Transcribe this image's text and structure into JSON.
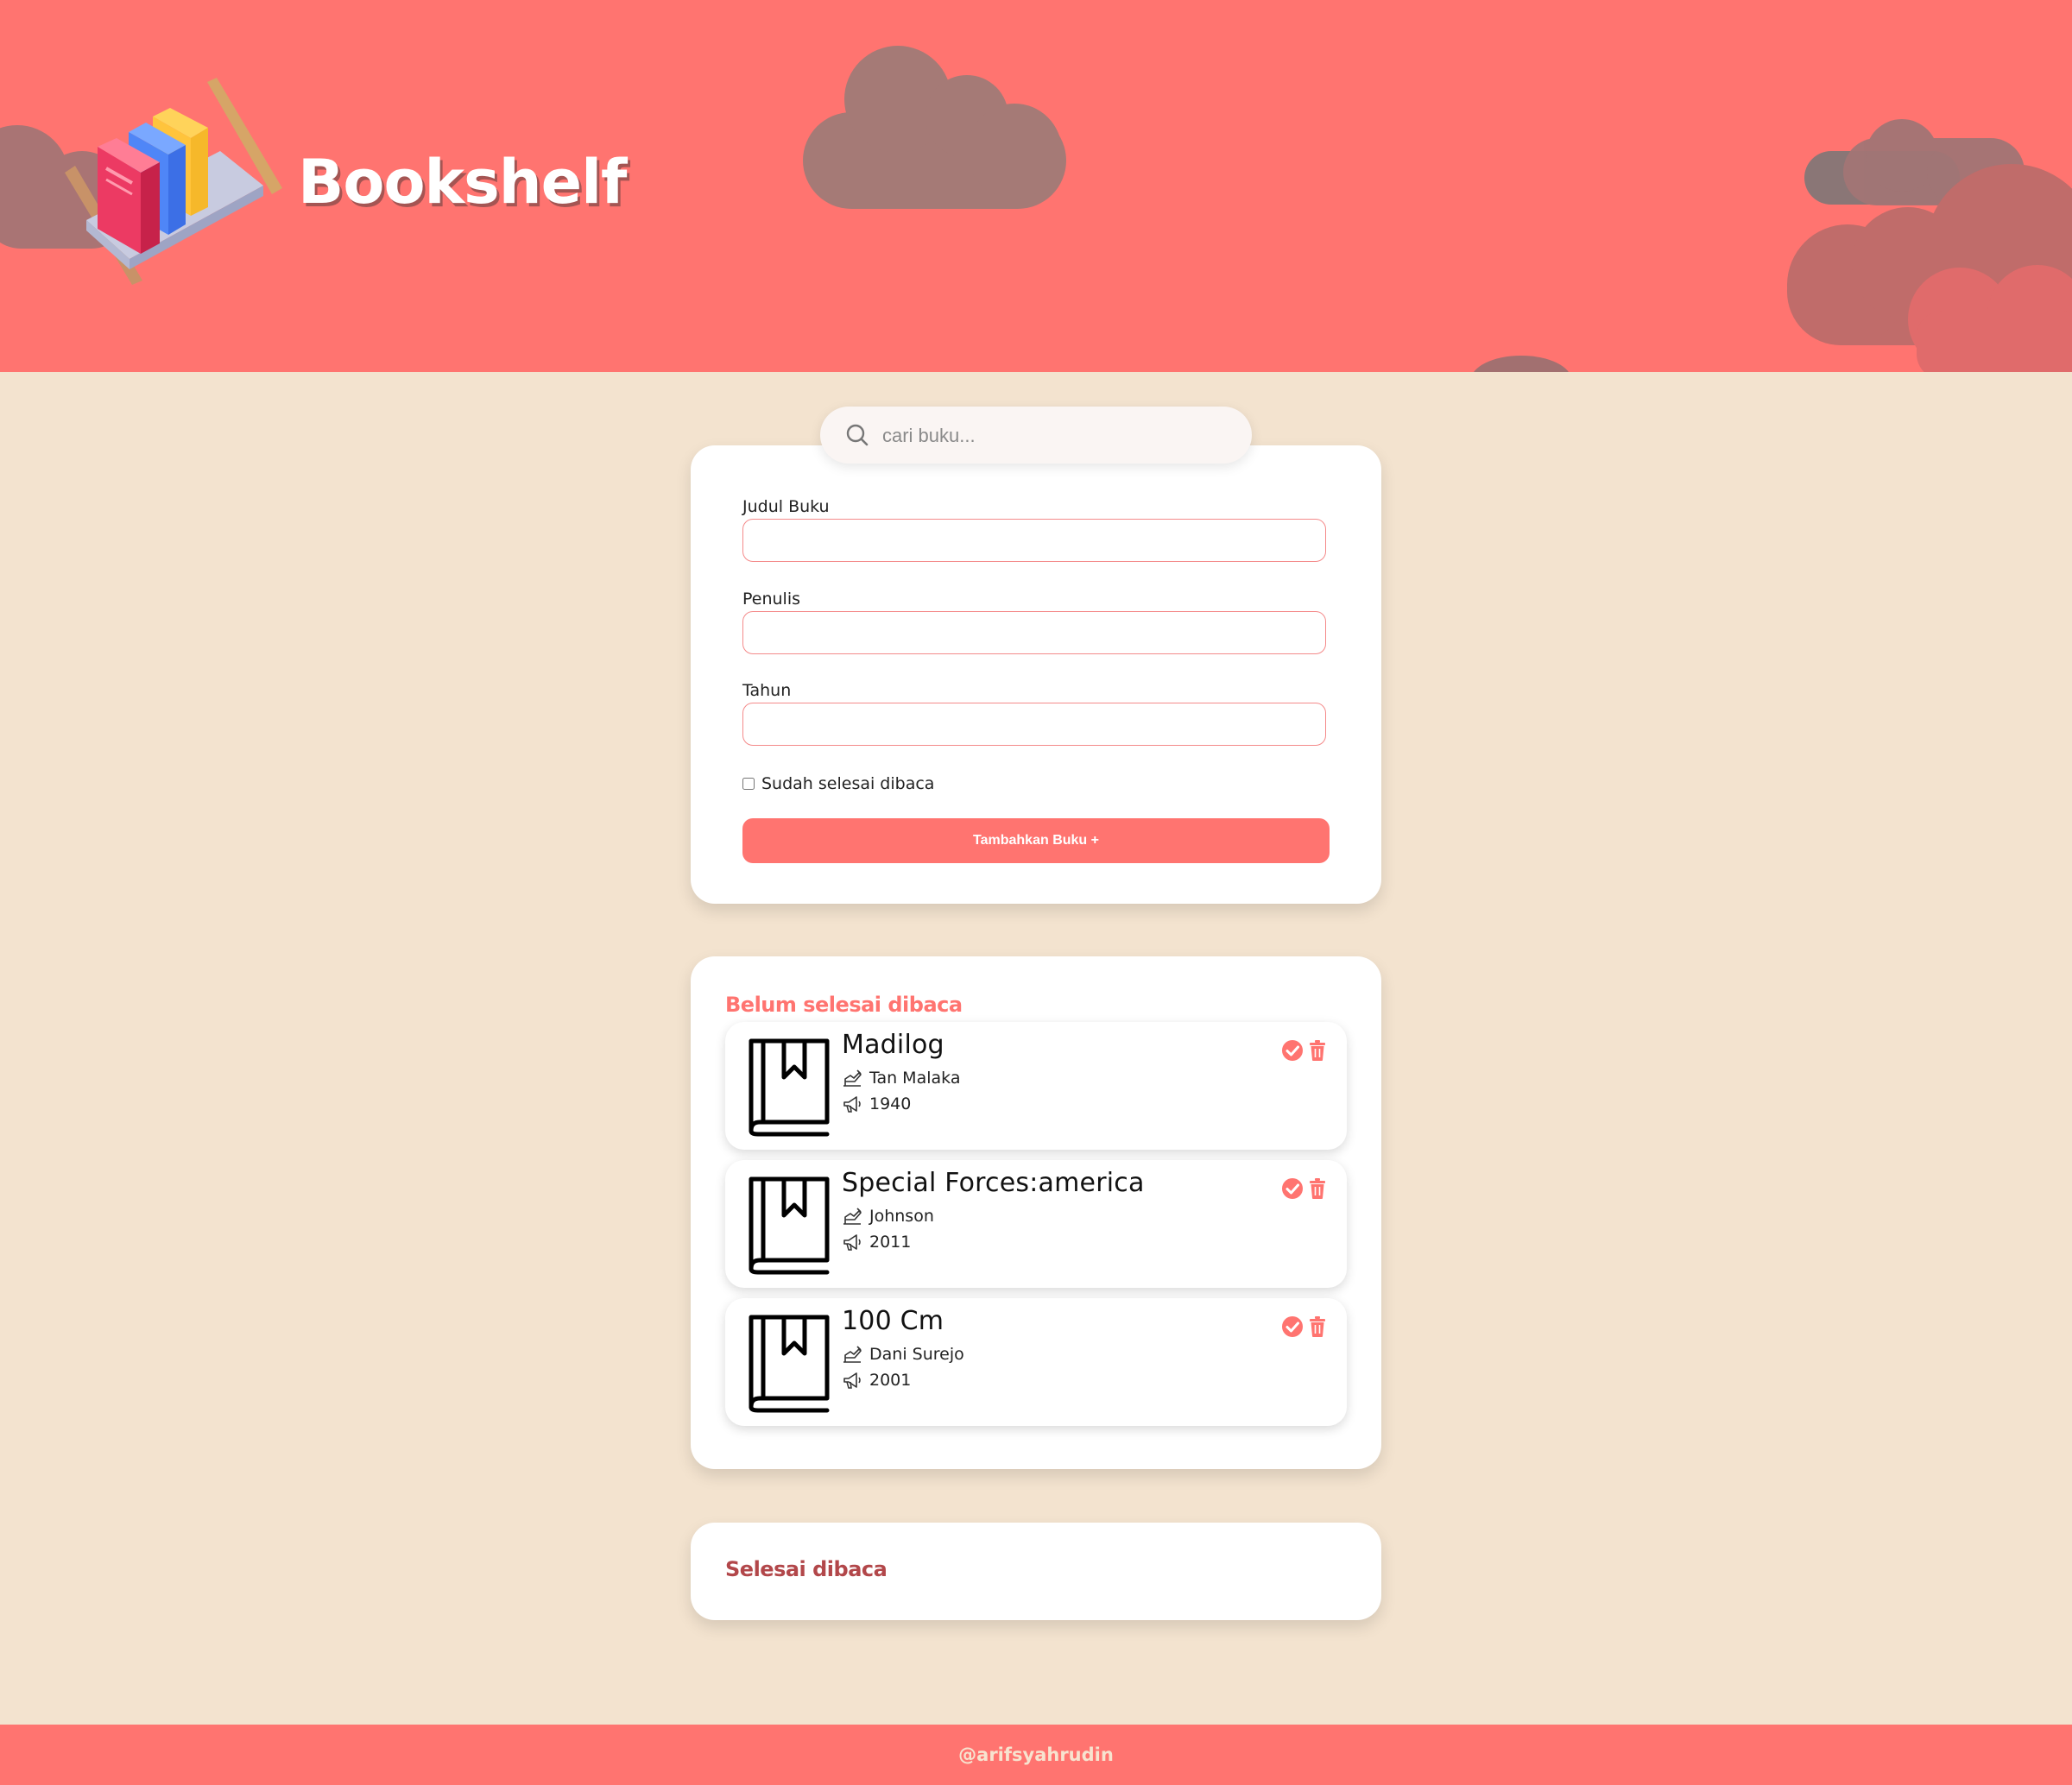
{
  "header": {
    "title": "Bookshelf",
    "logo_icon": "bookshelf-logo-icon",
    "background_color": "#ff7470"
  },
  "search": {
    "placeholder": "cari buku...",
    "value": "",
    "icon": "search-icon"
  },
  "form": {
    "title_label": "Judul Buku",
    "title_value": "",
    "author_label": "Penulis",
    "author_value": "",
    "year_label": "Tahun",
    "year_value": "",
    "finished_label": "Sudah selesai dibaca",
    "finished_checked": false,
    "submit_label": "Tambahkan Buku +"
  },
  "unread": {
    "heading": "Belum selesai dibaca",
    "books": [
      {
        "title": "Madilog",
        "author": "Tan Malaka",
        "year": "1940"
      },
      {
        "title": "Special Forces:america",
        "author": "Johnson",
        "year": "2011"
      },
      {
        "title": "100 Cm",
        "author": "Dani Surejo",
        "year": "2001"
      }
    ]
  },
  "read": {
    "heading": "Selesai dibaca",
    "books": []
  },
  "footer": {
    "credit": "@arifsyahrudin"
  },
  "colors": {
    "accent": "#ff7470",
    "background": "#f3e3cf",
    "read_heading": "#b2474a",
    "card": "#ffffff"
  }
}
